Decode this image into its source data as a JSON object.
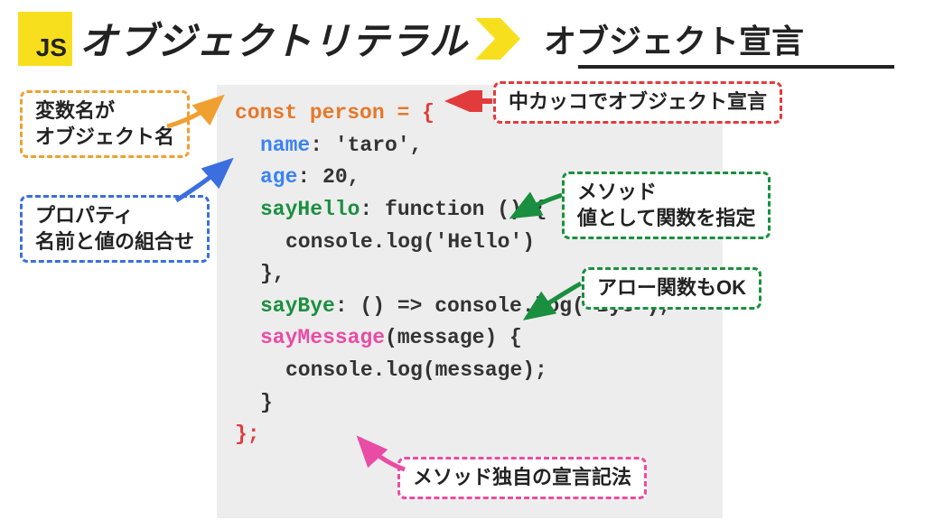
{
  "header": {
    "badge": "JS",
    "title_main": "オブジェクトリテラル",
    "title_sub": "オブジェクト宣言"
  },
  "callouts": {
    "orange": "変数名が\nオブジェクト名",
    "blue": "プロパティ\n名前と値の組合せ",
    "red": "中カッコでオブジェクト宣言",
    "green1": "メソッド\n値として関数を指定",
    "green2": "アロー関数もOK",
    "pink": "メソッド独自の宣言記法"
  },
  "code": {
    "const": "const",
    "person": "person",
    "eq": "=",
    "brace_open": "{",
    "name_key": "name",
    "name_val": ": 'taro',",
    "age_key": "age",
    "age_val": ": 20,",
    "sayHello_key": "sayHello",
    "sayHello_val": ": function () {",
    "console_hello": "console.log('Hello')",
    "brace_close_comma": "},",
    "sayBye_key": "sayBye",
    "sayBye_val": ": () => console.log('Bye'),",
    "sayMessage_key": "sayMessage",
    "sayMessage_val": "(message) {",
    "console_msg": "console.log(message);",
    "brace_close": "}",
    "end": "};"
  }
}
